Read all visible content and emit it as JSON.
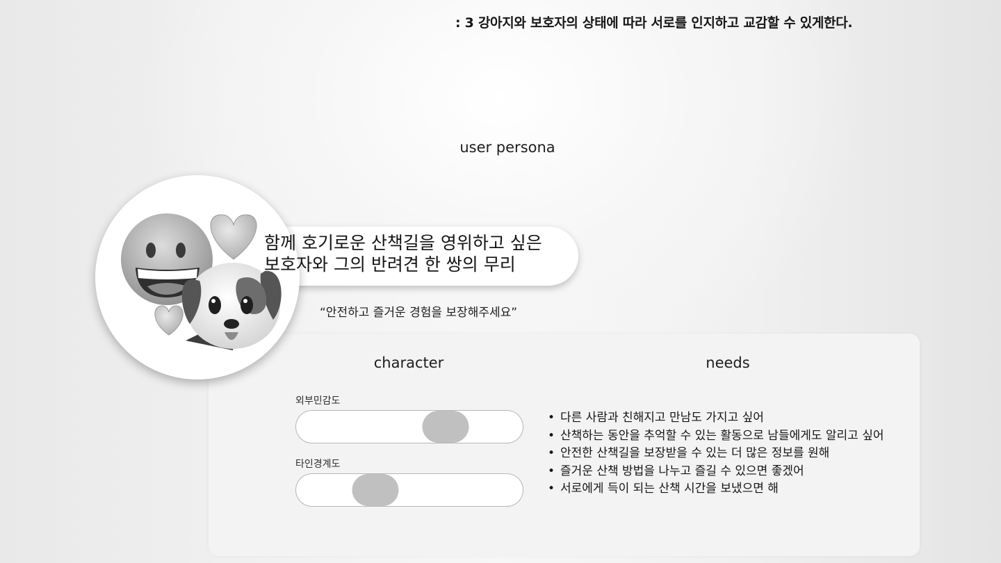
{
  "header": {
    "heading": ": 3 강아지와 보호자의 상태에 따라 서로를 인지하고 교감할 수 있게한다."
  },
  "persona": {
    "label": "user persona",
    "avatar_icons": [
      "grinning-face-icon",
      "heart-icon",
      "dog-face-icon",
      "heart-icon"
    ],
    "bubble_line1": "함께 호기로운 산책길을 영위하고 싶은",
    "bubble_line2": "보호자와 그의 반려견 한 쌍의 무리",
    "quote": "“안전하고 즐거운 경험을 보장해주세요”"
  },
  "character": {
    "title": "character",
    "sliders": [
      {
        "label": "외부민감도",
        "value": 0.66
      },
      {
        "label": "타인경계도",
        "value": 0.35
      }
    ]
  },
  "needs": {
    "title": "needs",
    "items": [
      "다른 사람과 친해지고 만남도 가지고 싶어",
      "산책하는 동안을 추억할 수 있는 활동으로 남들에게도  알리고 싶어",
      "안전한 산책길을 보장받을 수 있는 더 많은 정보를 원해",
      "즐거운 산책 방법을 나누고 즐길 수 있으면 좋겠어",
      "서로에게 득이 되는 산책 시간을 보냈으면 해"
    ]
  },
  "colors": {
    "panel": "#f3f3f3",
    "slider_thumb": "#c0c0c0",
    "slider_track": "#ffffff"
  }
}
